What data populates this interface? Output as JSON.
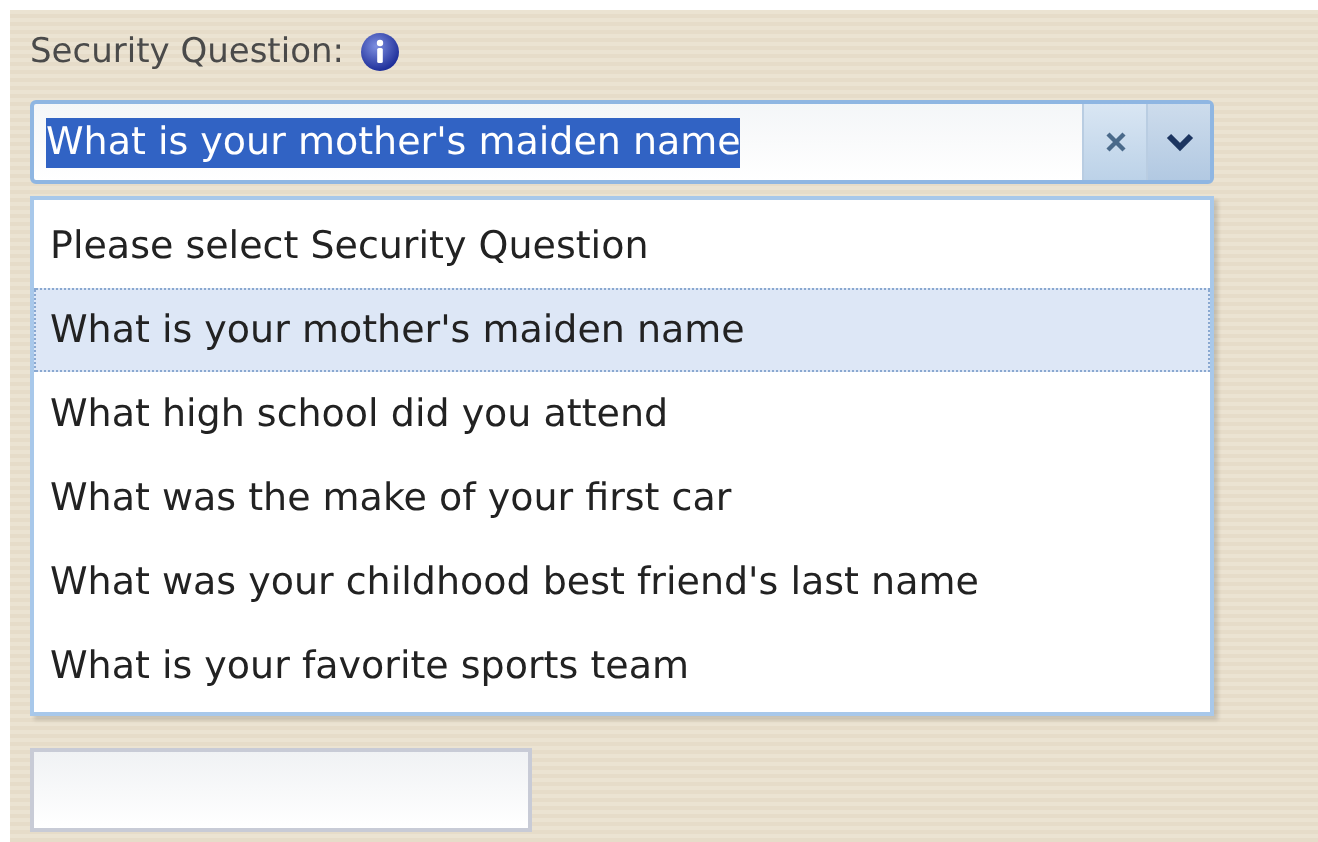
{
  "security_question": {
    "label": "Security Question:",
    "combo": {
      "value": "What is your mother's maiden name",
      "text_selected": true,
      "expanded": true
    },
    "options": [
      {
        "label": "Please select Security Question",
        "selected": false
      },
      {
        "label": "What is your mother's maiden name",
        "selected": true
      },
      {
        "label": "What high school did you attend",
        "selected": false
      },
      {
        "label": "What was the make of your first car",
        "selected": false
      },
      {
        "label": "What was your childhood best friend's last name",
        "selected": false
      },
      {
        "label": "What is your favorite sports team",
        "selected": false
      }
    ]
  }
}
